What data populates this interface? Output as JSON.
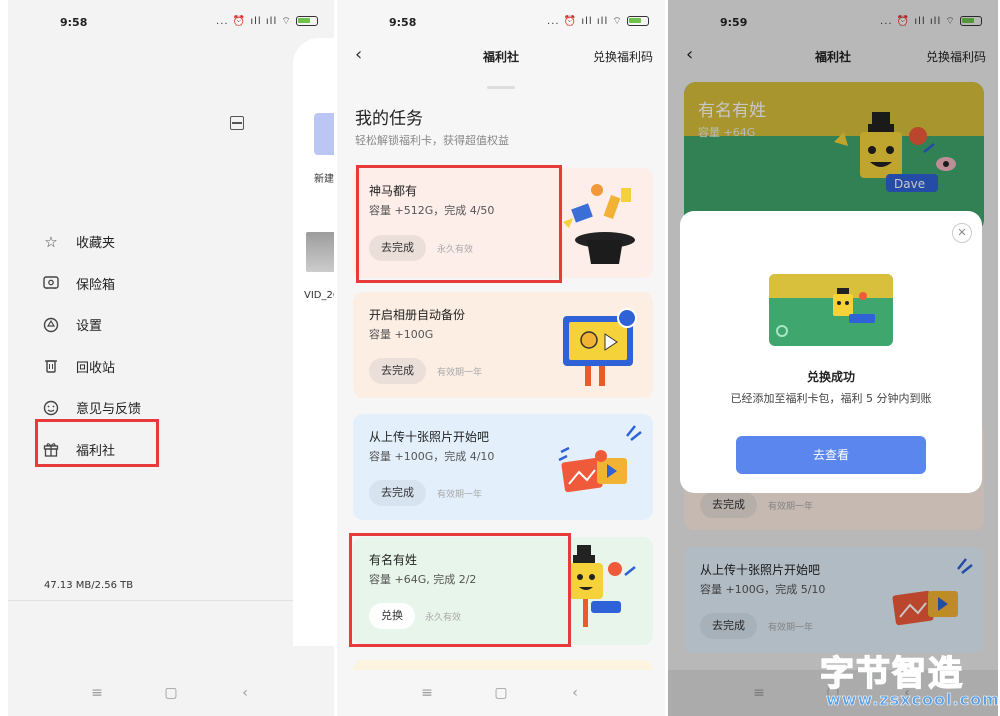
{
  "panel1": {
    "status": {
      "time": "9:58",
      "icons": "... ⏰ ıll ıll ⌔"
    },
    "drawer": {
      "new_label": "新建",
      "video_label": "VID_20",
      "menu": [
        {
          "icon": "star-icon",
          "label": "收藏夹"
        },
        {
          "icon": "safe-icon",
          "label": "保险箱"
        },
        {
          "icon": "settings-icon",
          "label": "设置"
        },
        {
          "icon": "trash-icon",
          "label": "回收站"
        },
        {
          "icon": "smile-icon",
          "label": "意见与反馈"
        },
        {
          "icon": "gift-icon",
          "label": "福利社"
        }
      ],
      "storage": "47.13 MB/2.56 TB"
    }
  },
  "panel2": {
    "status": {
      "time": "9:58"
    },
    "header": {
      "title": "福利社",
      "redeem": "兑换福利码"
    },
    "section": {
      "title": "我的任务",
      "subtitle": "轻松解锁福利卡，获得超值权益"
    },
    "tasks": [
      {
        "title": "神马都有",
        "desc": "容量 +512G，完成 4/50",
        "button": "去完成",
        "validity": "永久有效"
      },
      {
        "title": "开启相册自动备份",
        "desc": "容量 +100G",
        "button": "去完成",
        "validity": "有效期一年"
      },
      {
        "title": "从上传十张照片开始吧",
        "desc": "容量 +100G，完成 4/10",
        "button": "去完成",
        "validity": "有效期一年"
      },
      {
        "title": "有名有姓",
        "desc": "容量 +64G, 完成 2/2",
        "button": "兑换",
        "validity": "永久有效"
      }
    ]
  },
  "panel3": {
    "status": {
      "time": "9:59"
    },
    "header": {
      "title": "福利社",
      "redeem": "兑换福利码"
    },
    "card": {
      "name": "有名有姓",
      "capacity": "容量 +64G",
      "sticker": "Dave"
    },
    "below": [
      {
        "button": "去完成",
        "validity": "有效期一年"
      },
      {
        "title": "从上传十张照片开始吧",
        "desc": "容量 +100G，完成 5/10",
        "button": "去完成",
        "validity": "有效期一年"
      }
    ],
    "modal": {
      "title": "兑换成功",
      "desc": "已经添加至福利卡包，福利 5 分钟内到账",
      "button": "去查看"
    }
  },
  "watermark": {
    "cn": "字节智造",
    "url": "www.zsxcool.com"
  }
}
